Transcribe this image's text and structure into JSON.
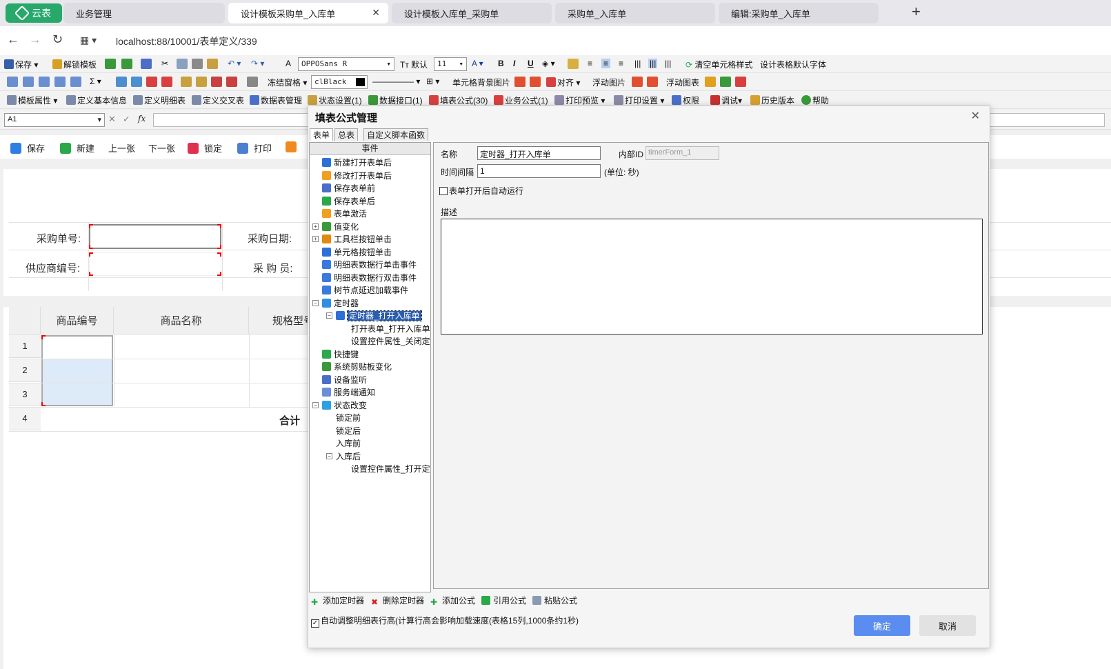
{
  "browser": {
    "home_tab": "云表",
    "tabs": [
      "业务管理",
      "设计模板采购单_入库单",
      "设计模板入库单_采购单",
      "采购单_入库单",
      "编辑:采购单_入库单"
    ],
    "url": "localhost:88/10001/表单定义/339"
  },
  "toolbar1": {
    "save": "保存",
    "unlock": "解锁模板",
    "font": "OPPOSans R",
    "default_font": "默认",
    "font_size": "11",
    "bold": "B",
    "italic": "I",
    "underline": "U",
    "clear_style": "清空单元格样式",
    "design_default_font": "设计表格默认字体"
  },
  "toolbar2": {
    "sigma": "Σ",
    "freeze": "冻结窗格",
    "color": "clBlack",
    "cell_bg": "单元格背景图片",
    "align": "对齐",
    "float_image": "浮动图片",
    "float_chart": "浮动图表"
  },
  "toolbar3": {
    "items": [
      "模板属性",
      "定义基本信息",
      "定义明细表",
      "定义交叉表",
      "数据表管理",
      "状态设置(1)",
      "数据接口(1)",
      "填表公式(30)",
      "业务公式(1)",
      "打印预览",
      "打印设置",
      "权限",
      "调试",
      "历史版本",
      "帮助"
    ]
  },
  "formula_bar": {
    "cell_ref": "A1",
    "fx": "fx"
  },
  "actions": [
    "保存",
    "新建",
    "上一张",
    "下一张",
    "锁定",
    "打印"
  ],
  "form": {
    "labels": [
      "采购单号:",
      "采购日期:",
      "供应商编号:",
      "采 购 员:"
    ],
    "table_headers": [
      "商品编号",
      "商品名称",
      "规格型号"
    ],
    "rows": [
      "1",
      "2",
      "3",
      "4"
    ],
    "total": "合计"
  },
  "dialog": {
    "title": "填表公式管理",
    "close": "✕",
    "tabs": [
      "表单",
      "总表",
      "自定义脚本函数"
    ],
    "tree_header": "事件",
    "tree": [
      {
        "label": "新建打开表单后",
        "color": "#2f6fd8"
      },
      {
        "label": "修改打开表单后",
        "color": "#f0a020"
      },
      {
        "label": "保存表单前",
        "color": "#4b6fc8"
      },
      {
        "label": "保存表单后",
        "color": "#2aa84a"
      },
      {
        "label": "表单激活",
        "color": "#f0a020"
      },
      {
        "label": "值变化",
        "color": "#3a9a3a"
      },
      {
        "label": "工具栏按钮单击",
        "color": "#e08a10"
      },
      {
        "label": "单元格按钮单击",
        "color": "#2f6fd8"
      },
      {
        "label": "明细表数据行单击事件",
        "color": "#3a7ae0"
      },
      {
        "label": "明细表数据行双击事件",
        "color": "#3a7ae0"
      },
      {
        "label": "树节点延迟加载事件",
        "color": "#3a7ae0"
      },
      {
        "label": "定时器",
        "color": "#2f8fe0"
      },
      {
        "label": "定时器_打开入库单",
        "color": "#2f6fd8"
      },
      {
        "label": "打开表单_打开入库单",
        "color": ""
      },
      {
        "label": "设置控件属性_关闭定",
        "color": ""
      },
      {
        "label": "快捷键",
        "color": "#2aa84a"
      },
      {
        "label": "系统剪贴板变化",
        "color": "#3a9a3a"
      },
      {
        "label": "设备监听",
        "color": "#4b6fc8"
      },
      {
        "label": "服务端通知",
        "color": "#6a8fd8"
      },
      {
        "label": "状态改变",
        "color": "#2f9fe0"
      },
      {
        "label": "锁定前",
        "color": ""
      },
      {
        "label": "锁定后",
        "color": ""
      },
      {
        "label": "入库前",
        "color": ""
      },
      {
        "label": "入库后",
        "color": ""
      },
      {
        "label": "设置控件属性_打开定",
        "color": ""
      }
    ],
    "props": {
      "name_label": "名称",
      "name_value": "定时器_打开入库单",
      "id_label": "内部ID",
      "id_value": "timerForm_1",
      "interval_label": "时间间隔",
      "interval_value": "1",
      "unit": "(单位: 秒)",
      "autorun": "表单打开后自动运行",
      "desc_label": "描述"
    },
    "bottom_actions": [
      "添加定时器",
      "删除定时器",
      "添加公式",
      "引用公式",
      "粘贴公式"
    ],
    "auto_adjust": "自动调整明细表行高(计算行高会影响加载速度(表格15列,1000条约1秒)",
    "ok": "确定",
    "cancel": "取消"
  }
}
